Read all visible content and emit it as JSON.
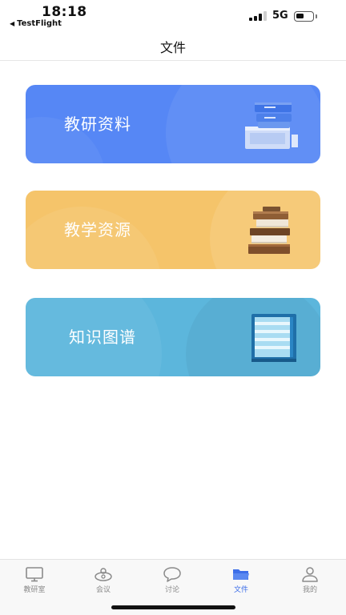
{
  "status_bar": {
    "time": "18:18",
    "back_app": "TestFlight",
    "network": "5G",
    "signal_bars": 3,
    "signal_bars_max": 4,
    "battery_level": 0.45
  },
  "header": {
    "title": "文件"
  },
  "cards": [
    {
      "label": "教研资料",
      "icon": "file-cabinet-icon",
      "color": "#5687f5"
    },
    {
      "label": "教学资源",
      "icon": "book-stack-icon",
      "color": "#f5c46a"
    },
    {
      "label": "知识图谱",
      "icon": "shelf-icon",
      "color": "#5cb6dc"
    }
  ],
  "tab_bar": {
    "active_color": "#3d6ee8",
    "inactive_color": "#8a8a8a",
    "tabs": [
      {
        "label": "教研室",
        "icon": "monitor-icon",
        "active": false
      },
      {
        "label": "会议",
        "icon": "meeting-icon",
        "active": false
      },
      {
        "label": "讨论",
        "icon": "chat-bubble-icon",
        "active": false
      },
      {
        "label": "文件",
        "icon": "folder-icon",
        "active": true
      },
      {
        "label": "我的",
        "icon": "person-icon",
        "active": false
      }
    ]
  }
}
